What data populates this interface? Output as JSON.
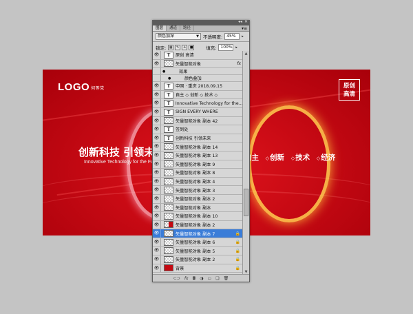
{
  "banner": {
    "logo_text": "LOGO",
    "logo_sub": "何等党",
    "stamp_line1": "原创",
    "stamp_line2": "高清",
    "slogan": "创新科技 引领未",
    "slogan_en": "Innovative Technology for the Fu",
    "keywords": [
      "自主",
      "创新",
      "技术",
      "经济"
    ]
  },
  "panel": {
    "tabs": [
      "图层",
      "通道",
      "路径"
    ],
    "blend_mode": "颜色加深",
    "opacity_label": "不透明度:",
    "opacity_value": "45%",
    "lock_label": "锁定:",
    "fill_label": "填充:",
    "fill_value": "100%",
    "layers": [
      {
        "name": "原创 高清",
        "thumb": "text"
      },
      {
        "name": "矢量智能对象",
        "thumb": "check",
        "fx": "fx"
      },
      {
        "name": "效果",
        "thumb": "none",
        "level": 1
      },
      {
        "name": "颜色叠加",
        "thumb": "none",
        "level": 2
      },
      {
        "name": "中国 · 重庆  2018.09.15",
        "thumb": "text"
      },
      {
        "name": "自主   ◇ 创新   ◇ 技术   ◇",
        "thumb": "text"
      },
      {
        "name": "Innovative Technology for the ...",
        "thumb": "text"
      },
      {
        "name": "SIGN EVERY WHERE",
        "thumb": "text"
      },
      {
        "name": "矢量智能对象 副本 42",
        "thumb": "check"
      },
      {
        "name": "签到处",
        "thumb": "text"
      },
      {
        "name": "创新科技  引领未来",
        "thumb": "text"
      },
      {
        "name": "矢量智能对象 副本 14",
        "thumb": "check"
      },
      {
        "name": "矢量智能对象 副本 13",
        "thumb": "check"
      },
      {
        "name": "矢量智能对象 副本 9",
        "thumb": "check"
      },
      {
        "name": "矢量智能对象 副本 8",
        "thumb": "check"
      },
      {
        "name": "矢量智能对象 副本 4",
        "thumb": "check"
      },
      {
        "name": "矢量智能对象 副本 3",
        "thumb": "check"
      },
      {
        "name": "矢量智能对象 副本 2",
        "thumb": "check"
      },
      {
        "name": "矢量智能对象 副本",
        "thumb": "check"
      },
      {
        "name": "矢量智能对象 副本 10",
        "thumb": "check"
      },
      {
        "name": "矢量智能对象 副本 2",
        "thumb": "redcheck"
      },
      {
        "name": "矢量智能对象 副本 7",
        "thumb": "check",
        "selected": true,
        "lock": "🔒"
      },
      {
        "name": "矢量智能对象 副本 6",
        "thumb": "check",
        "lock": "🔒"
      },
      {
        "name": "矢量智能对象 副本 5",
        "thumb": "check",
        "lock": "🔒"
      },
      {
        "name": "矢量智能对象 副本 2",
        "thumb": "check",
        "lock": "🔒"
      },
      {
        "name": "背景",
        "thumb": "red",
        "lock": "🔒"
      }
    ],
    "footer_icons": [
      "link-icon",
      "fx-icon",
      "mask-icon",
      "adjustment-icon",
      "folder-icon",
      "new-layer-icon",
      "trash-icon"
    ]
  }
}
